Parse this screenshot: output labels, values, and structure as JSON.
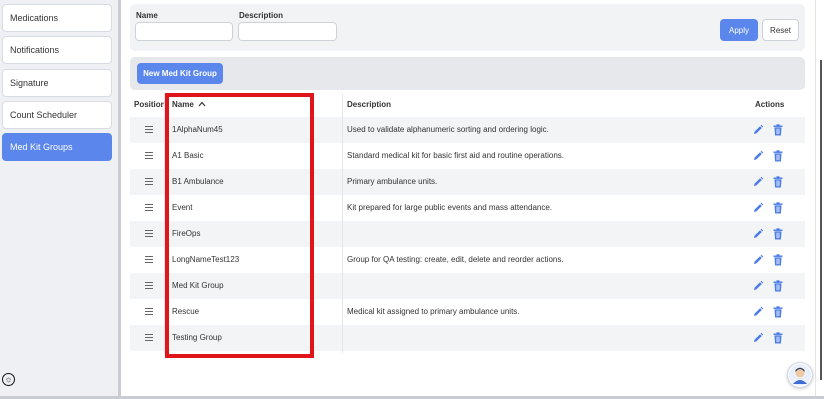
{
  "sidebar": {
    "items": [
      {
        "label": "Medications"
      },
      {
        "label": "Notifications"
      },
      {
        "label": "Signature"
      },
      {
        "label": "Count Scheduler"
      },
      {
        "label": "Med Kit Groups",
        "active": true
      }
    ]
  },
  "filter": {
    "name_label": "Name",
    "description_label": "Description",
    "name_value": "",
    "description_value": "",
    "apply_label": "Apply",
    "reset_label": "Reset"
  },
  "toolbar": {
    "new_label": "New Med Kit Group"
  },
  "table": {
    "headers": {
      "position": "Position",
      "name": "Name",
      "description": "Description",
      "actions": "Actions"
    },
    "sort": {
      "column": "name",
      "direction": "ascending",
      "icon": "chevron-up-icon"
    },
    "rows": [
      {
        "name": "1AlphaNum45",
        "description": "Used to validate alphanumeric sorting and ordering logic."
      },
      {
        "name": "A1 Basic",
        "description": "Standard medical kit for basic first aid and routine operations."
      },
      {
        "name": "B1 Ambulance",
        "description": "Primary ambulance units."
      },
      {
        "name": "Event",
        "description": "Kit prepared for large public events and mass attendance."
      },
      {
        "name": "FireOps",
        "description": ""
      },
      {
        "name": "LongNameTest123",
        "description": "Group for QA testing: create, edit, delete and reorder actions."
      },
      {
        "name": "Med Kit Group",
        "description": ""
      },
      {
        "name": "Rescue",
        "description": "Medical kit assigned to primary ambulance units."
      },
      {
        "name": "Testing Group",
        "description": ""
      }
    ]
  },
  "colors": {
    "accent": "#5b86ec",
    "highlight": "#e0151a",
    "row_alt": "#f3f4f6"
  },
  "icons": {
    "row_drag": "drag-handle-icon",
    "row_edit": "pencil-icon",
    "row_delete": "trash-icon",
    "accessibility": "accessibility-icon",
    "help": "support-avatar-icon"
  }
}
